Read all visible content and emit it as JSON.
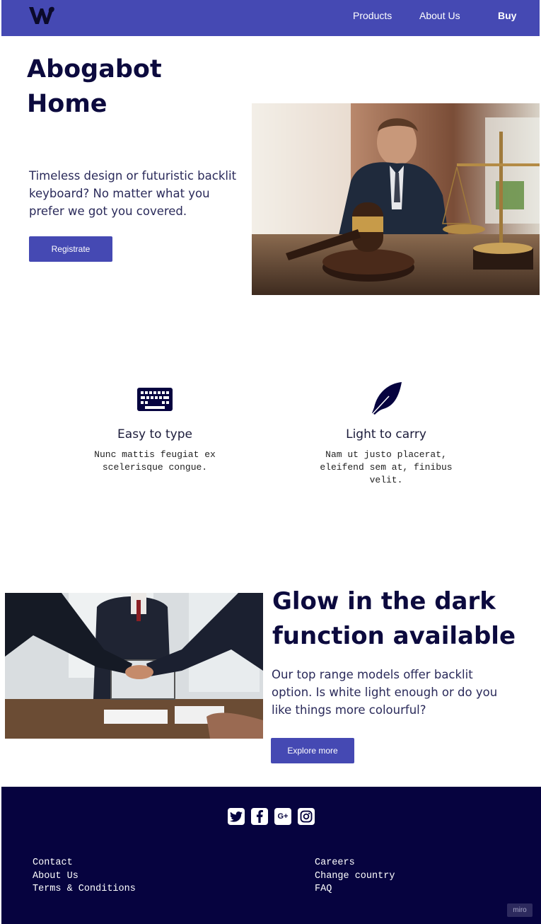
{
  "nav": {
    "products": "Products",
    "about": "About Us",
    "buy": "Buy"
  },
  "hero": {
    "title": "Abogabot Home",
    "text": "Timeless design or futuristic backlit keyboard? No matter what you prefer we got you covered.",
    "button": "Registrate"
  },
  "features": [
    {
      "title": "Easy to type",
      "desc": "Nunc mattis feugiat ex scelerisque congue.",
      "icon": "keyboard-icon"
    },
    {
      "title": "Light to carry",
      "desc": "Nam ut justo placerat, eleifend sem at, finibus velit.",
      "icon": "feather-icon"
    }
  ],
  "section2": {
    "title": "Glow in the dark function available",
    "text": "Our top range models offer backlit option. Is white light enough or do you like things more colourful?",
    "button": "Explore more"
  },
  "footer": {
    "social": [
      "twitter-icon",
      "facebook-icon",
      "google-plus-icon",
      "instagram-icon"
    ],
    "google_label": "G+",
    "col1": [
      "Contact",
      "About Us",
      "Terms & Conditions"
    ],
    "col2": [
      "Careers",
      "Change country",
      "FAQ"
    ],
    "badge": "miro"
  },
  "colors": {
    "brand": "#4549b3",
    "dark": "#06033f",
    "text": "#0c0a3e"
  }
}
